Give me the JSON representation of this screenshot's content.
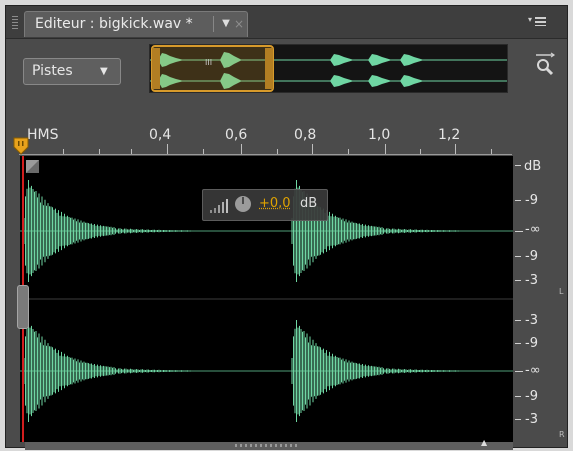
{
  "tab": {
    "title": "Editeur : bigkick.wav *",
    "dropdown_glyph": "▼",
    "close_glyph": "×"
  },
  "tracks_dropdown": {
    "label": "Pistes",
    "caret": "▼"
  },
  "overview": {
    "handle_mark": "III"
  },
  "ruler": {
    "format_label": "HMS",
    "tick_labels": [
      "0,4",
      "0,6",
      "0,8",
      "1,0",
      "1,2"
    ]
  },
  "hud": {
    "volume_value": "+0,0",
    "volume_unit": "dB"
  },
  "db_scale": {
    "unit": "dB",
    "top_channel_labels": [
      "-9",
      "-∞",
      "-9",
      "-3"
    ],
    "bottom_channel_labels": [
      "-3",
      "-9",
      "-∞",
      "-9",
      "-3"
    ],
    "left_channel": "L",
    "right_channel": "R"
  },
  "colors": {
    "waveform": "#6fd6a3",
    "playhead": "#d31e1e",
    "selection": "#d79a2b",
    "hud_value": "#e0a300"
  }
}
